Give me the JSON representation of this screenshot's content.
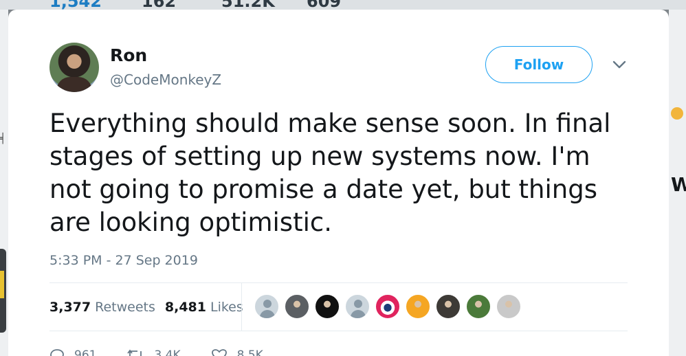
{
  "background_stats": [
    "1,542",
    "162",
    "51.2K",
    "609"
  ],
  "tweet": {
    "author_name": "Ron",
    "author_handle": "@CodeMonkeyZ",
    "follow_label": "Follow",
    "text": "Everything should make sense soon. In final stages of setting up new systems now. I'm not going to promise a date yet, but things are looking optimistic.",
    "timestamp": "5:33 PM - 27 Sep 2019"
  },
  "stats": {
    "retweets_count": "3,377",
    "retweets_label": "Retweets",
    "likes_count": "8,481",
    "likes_label": "Likes"
  },
  "likers": [
    {
      "name": "liker-avatar-1",
      "color": "#ccd6dd",
      "kind": "default"
    },
    {
      "name": "liker-avatar-2",
      "color": "#5b5f63",
      "kind": "photo"
    },
    {
      "name": "liker-avatar-3",
      "color": "#111111",
      "kind": "photo"
    },
    {
      "name": "liker-avatar-4",
      "color": "#ccd6dd",
      "kind": "default"
    },
    {
      "name": "liker-avatar-5",
      "color": "#e0245e",
      "kind": "lion"
    },
    {
      "name": "liker-avatar-6",
      "color": "#f5a623",
      "kind": "photo"
    },
    {
      "name": "liker-avatar-7",
      "color": "#3d3a36",
      "kind": "photo"
    },
    {
      "name": "liker-avatar-8",
      "color": "#4b7a3a",
      "kind": "photo"
    },
    {
      "name": "liker-avatar-9",
      "color": "#c9c9c9",
      "kind": "photo"
    }
  ],
  "actions": {
    "reply_count": "961",
    "retweet_count": "3.4K",
    "like_count": "8.5K"
  },
  "colors": {
    "accent": "#1da1f2",
    "text_primary": "#14171a",
    "text_secondary": "#657786"
  }
}
